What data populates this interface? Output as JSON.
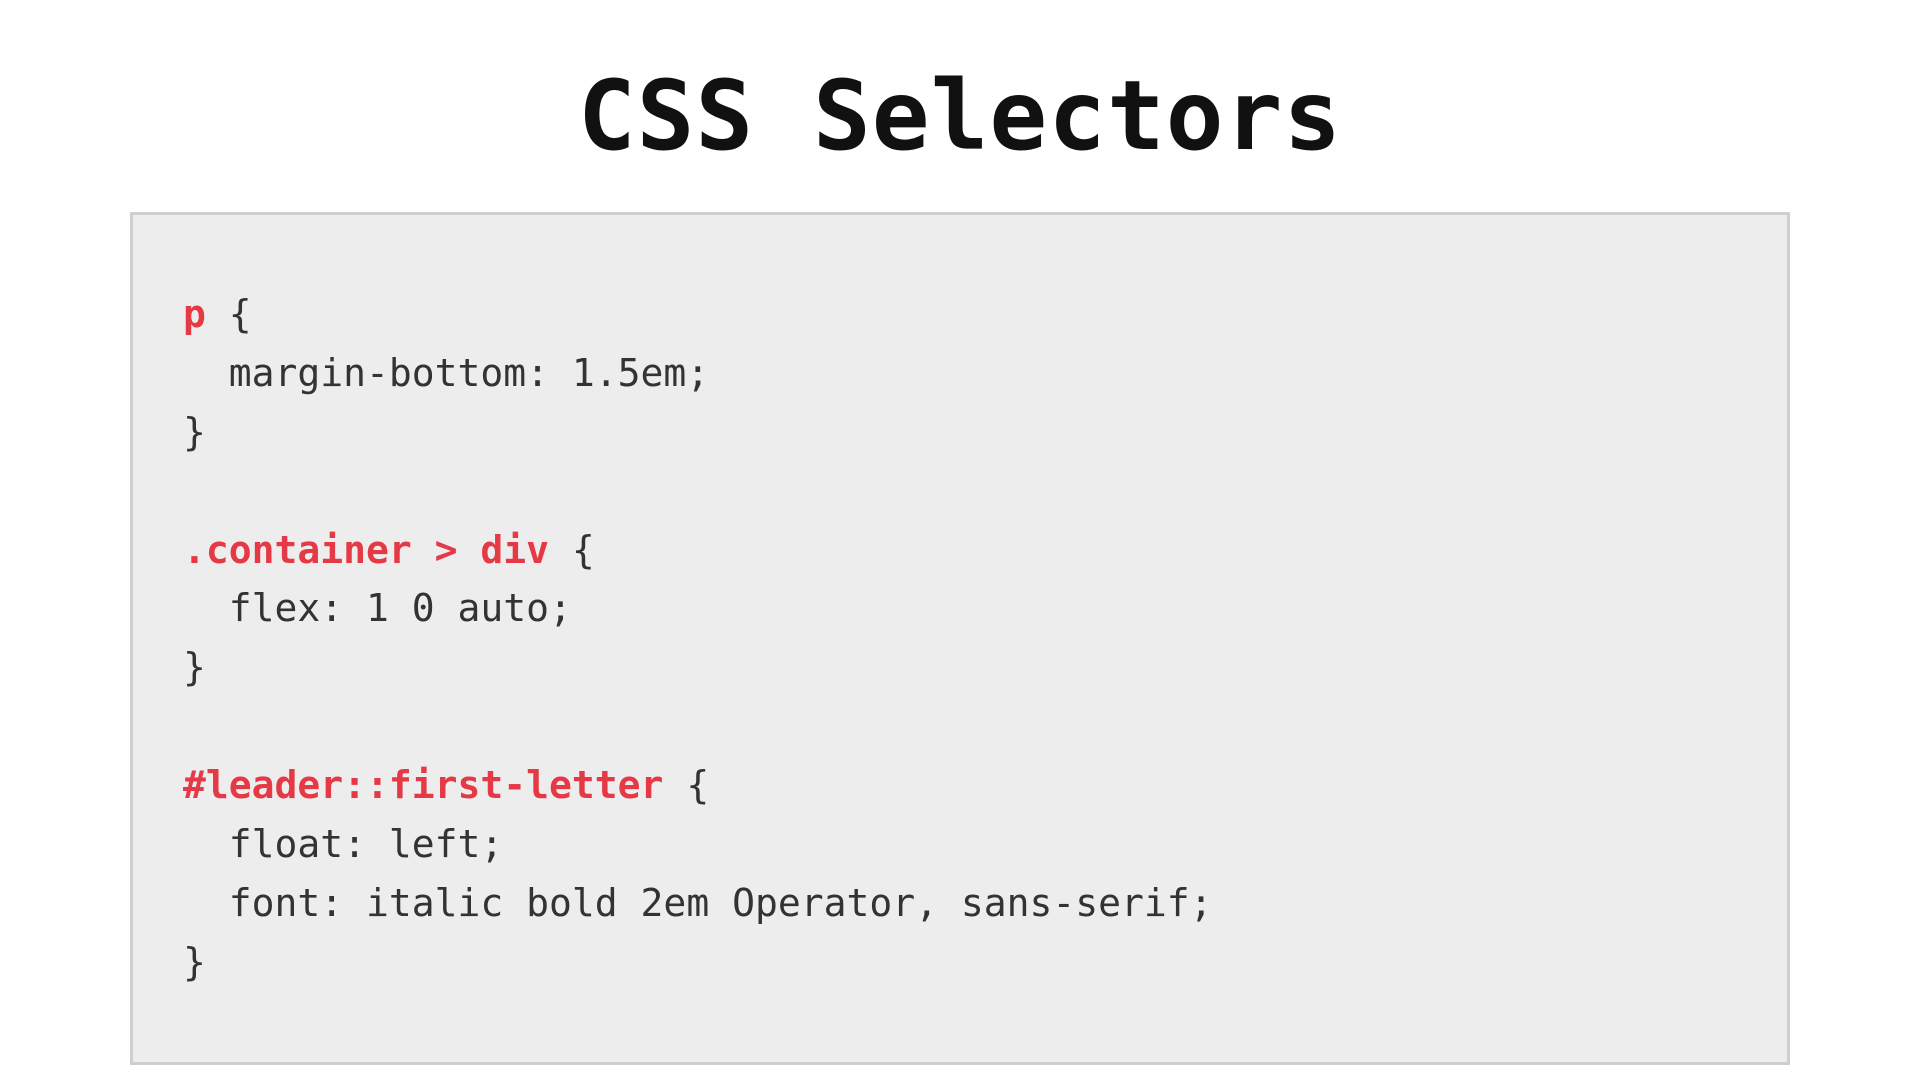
{
  "title": "CSS Selectors",
  "colors": {
    "selector": "#e63946",
    "code_bg": "#ededed",
    "code_border": "#cfcfcf"
  },
  "code": {
    "rules": [
      {
        "selector": "p",
        "open": " {",
        "declarations": [
          "  margin-bottom: 1.5em;"
        ],
        "close": "}"
      },
      {
        "selector": ".container > div",
        "open": " {",
        "declarations": [
          "  flex: 1 0 auto;"
        ],
        "close": "}"
      },
      {
        "selector": "#leader::first-letter",
        "open": " {",
        "declarations": [
          "  float: left;",
          "  font: italic bold 2em Operator, sans-serif;"
        ],
        "close": "}"
      }
    ]
  }
}
